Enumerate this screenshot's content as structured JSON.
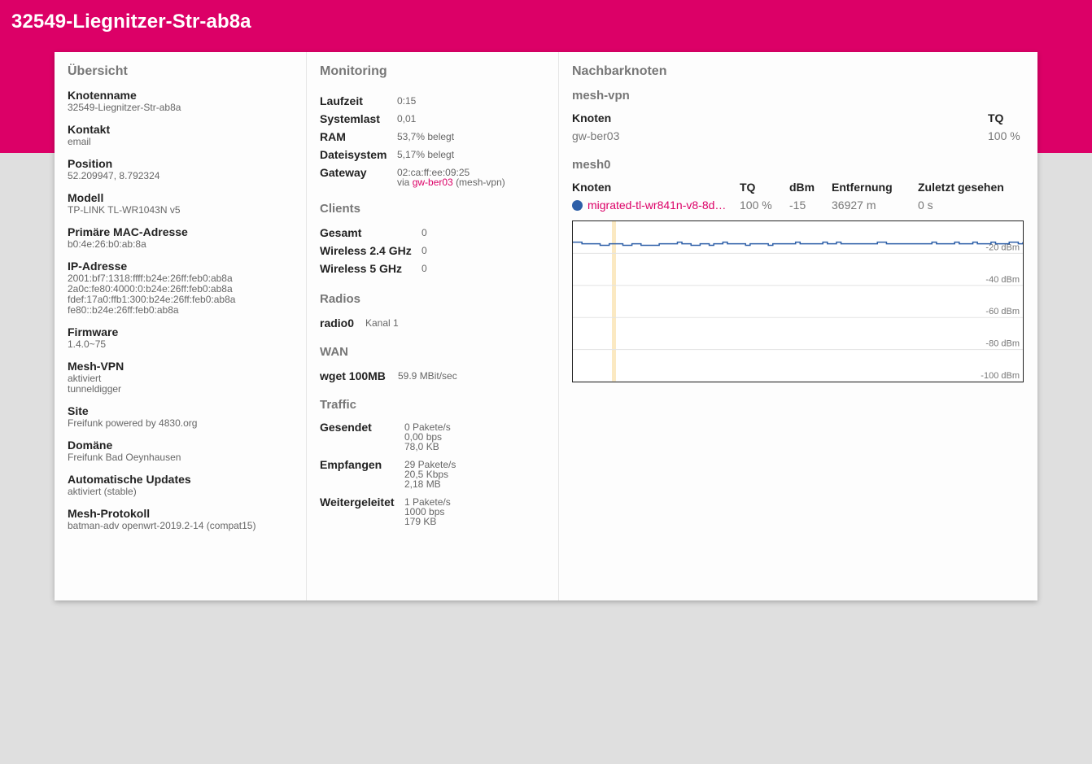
{
  "header": {
    "title": "32549-Liegnitzer-Str-ab8a"
  },
  "overview": {
    "title": "Übersicht",
    "items": [
      {
        "key": "Knotenname",
        "value": "32549-Liegnitzer-Str-ab8a"
      },
      {
        "key": "Kontakt",
        "value": "email"
      },
      {
        "key": "Position",
        "value": "52.209947, 8.792324"
      },
      {
        "key": "Modell",
        "value": "TP-LINK TL-WR1043N v5"
      },
      {
        "key": "Primäre MAC-Adresse",
        "value": "b0:4e:26:b0:ab:8a"
      },
      {
        "key": "IP-Adresse",
        "lines": [
          "2001:bf7:1318:ffff:b24e:26ff:feb0:ab8a",
          "2a0c:fe80:4000:0:b24e:26ff:feb0:ab8a",
          "fdef:17a0:ffb1:300:b24e:26ff:feb0:ab8a",
          "fe80::b24e:26ff:feb0:ab8a"
        ]
      },
      {
        "key": "Firmware",
        "value": "1.4.0~75"
      },
      {
        "key": "Mesh-VPN",
        "lines": [
          "aktiviert",
          "tunneldigger"
        ]
      },
      {
        "key": "Site",
        "value": "Freifunk powered by 4830.org"
      },
      {
        "key": "Domäne",
        "value": "Freifunk Bad Oeynhausen"
      },
      {
        "key": "Automatische Updates",
        "value": "aktiviert (stable)"
      },
      {
        "key": "Mesh-Protokoll",
        "value": "batman-adv openwrt-2019.2-14 (compat15)"
      }
    ]
  },
  "monitoring": {
    "title": "Monitoring",
    "laufzeit_label": "Laufzeit",
    "laufzeit": "0:15",
    "systemlast_label": "Systemlast",
    "systemlast": "0,01",
    "ram_label": "RAM",
    "ram": "53,7% belegt",
    "datei_label": "Dateisystem",
    "datei": "5,17% belegt",
    "gateway_label": "Gateway",
    "gateway_mac": "02:ca:ff:ee:09:25",
    "gateway_via": "via",
    "gateway_link": "gw-ber03",
    "gateway_suffix": "(mesh-vpn)",
    "clients_title": "Clients",
    "gesamt_label": "Gesamt",
    "gesamt": "0",
    "w24_label": "Wireless 2.4 GHz",
    "w24": "0",
    "w5_label": "Wireless 5 GHz",
    "w5": "0",
    "radios_title": "Radios",
    "radio_label": "radio0",
    "radio_value": "Kanal 1",
    "wan_title": "WAN",
    "wan_label": "wget 100MB",
    "wan_value": "59.9 MBit/sec",
    "traffic_title": "Traffic",
    "gesendet_label": "Gesendet",
    "gesendet": [
      "0 Pakete/s",
      "0,00 bps",
      "78,0 KB"
    ],
    "empfangen_label": "Empfangen",
    "empfangen": [
      "29 Pakete/s",
      "20,5 Kbps",
      "2,18 MB"
    ],
    "weiter_label": "Weitergeleitet",
    "weiter": [
      "1 Pakete/s",
      "1000 bps",
      "179 KB"
    ]
  },
  "neighbours": {
    "title": "Nachbarknoten",
    "vpn_title": "mesh-vpn",
    "vpn_headers": {
      "knoten": "Knoten",
      "tq": "TQ"
    },
    "vpn_row": {
      "knoten": "gw-ber03",
      "tq": "100 %"
    },
    "mesh_title": "mesh0",
    "mesh_headers": {
      "knoten": "Knoten",
      "tq": "TQ",
      "dbm": "dBm",
      "entfernung": "Entfernung",
      "zuletzt": "Zuletzt gesehen"
    },
    "mesh_row": {
      "knoten": "migrated-tl-wr841n-v8-8d…",
      "tq": "100 %",
      "dbm": "-15",
      "entfernung": "36927 m",
      "zuletzt": "0 s"
    },
    "dot_color": "#2d5fa8"
  },
  "chart_data": {
    "type": "line",
    "ylabel_unit": "dBm",
    "ytick_labels": [
      "-20 dBm",
      "-40 dBm",
      "-60 dBm",
      "-80 dBm",
      "-100 dBm"
    ],
    "yticks": [
      -20,
      -40,
      -60,
      -80,
      -100
    ],
    "ylim": [
      -100,
      0
    ],
    "series": [
      {
        "values": [
          -13,
          -13,
          -14,
          -14,
          -14,
          -14,
          -15,
          -15,
          -14,
          -14,
          -14,
          -15,
          -15,
          -14,
          -14,
          -15,
          -15,
          -15,
          -15,
          -14,
          -14,
          -14,
          -14,
          -13,
          -14,
          -14,
          -15,
          -15,
          -14,
          -14,
          -15,
          -14,
          -14,
          -13,
          -14,
          -14,
          -14,
          -14,
          -15,
          -14,
          -14,
          -14,
          -14,
          -15,
          -14,
          -14,
          -14,
          -14,
          -14,
          -13,
          -14,
          -14,
          -14,
          -14,
          -14,
          -13,
          -14,
          -14,
          -13,
          -14,
          -14,
          -14,
          -14,
          -14,
          -14,
          -14,
          -14,
          -13,
          -13,
          -14,
          -14,
          -14,
          -14,
          -14,
          -14,
          -14,
          -14,
          -14,
          -14,
          -13,
          -14,
          -14,
          -14,
          -14,
          -13,
          -14,
          -14,
          -14,
          -13,
          -14,
          -14,
          -14,
          -13,
          -14,
          -14,
          -14,
          -13,
          -13,
          -14,
          -13
        ]
      }
    ],
    "color": "#2d5fa8",
    "highlight_color": "#fbe9c2"
  }
}
